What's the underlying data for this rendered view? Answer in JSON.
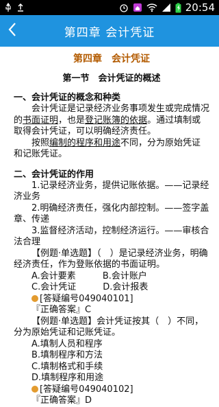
{
  "status": {
    "time": "20:54"
  },
  "appbar": {
    "title": "第四章 会计凭证"
  },
  "content": {
    "chapter_title": "第四章　会计凭证",
    "section_title": "第一节　会计凭证的概述",
    "h1": "一、会计凭证的概念和种类",
    "p1_a": "会计凭证是记录经济业务事项发生或完成情况的",
    "p1_u1": "书面证明",
    "p1_b": "，也是",
    "p1_u2": "登记账簿的依据",
    "p1_c": "。通过填制或取得会计凭证，可以明确经济责任。",
    "p2_a": "按照",
    "p2_u": "编制的程序和用途",
    "p2_b": "不同，分为原始凭证和记账凭证。",
    "h2": "二、会计凭证的作用",
    "r1": "1.记录经济业务，提供记账依据。——记录经济业务",
    "r2": "2.明确经济责任，强化内部控制。——签字盖章、传递",
    "r3": "3.监督经济活动，控制经济运行。——审核合法合理",
    "q1": "【例题·单选题】（　）是记录经济业务，明确经济责任，作为登账依据的书面证明。",
    "q1_opt_a": "A.会计要素",
    "q1_opt_b": "B.会计账户",
    "q1_opt_c": "C.会计凭证",
    "q1_opt_d": "D.会计报表",
    "q1_code": "[答疑编号049040101]",
    "q1_answer": "『正确答案』C",
    "q2": "【例题·单选题】会计凭证按其（　）不同，分为原始凭证和记账凭证。",
    "q2_opts": [
      "A.填制人员和程序",
      "B.填制程序和方法",
      "C.填制格式和手续",
      "D.填制程序和用途"
    ],
    "q2_code": "[答疑编号049040102]",
    "q2_answer": "『正确答案』D"
  }
}
